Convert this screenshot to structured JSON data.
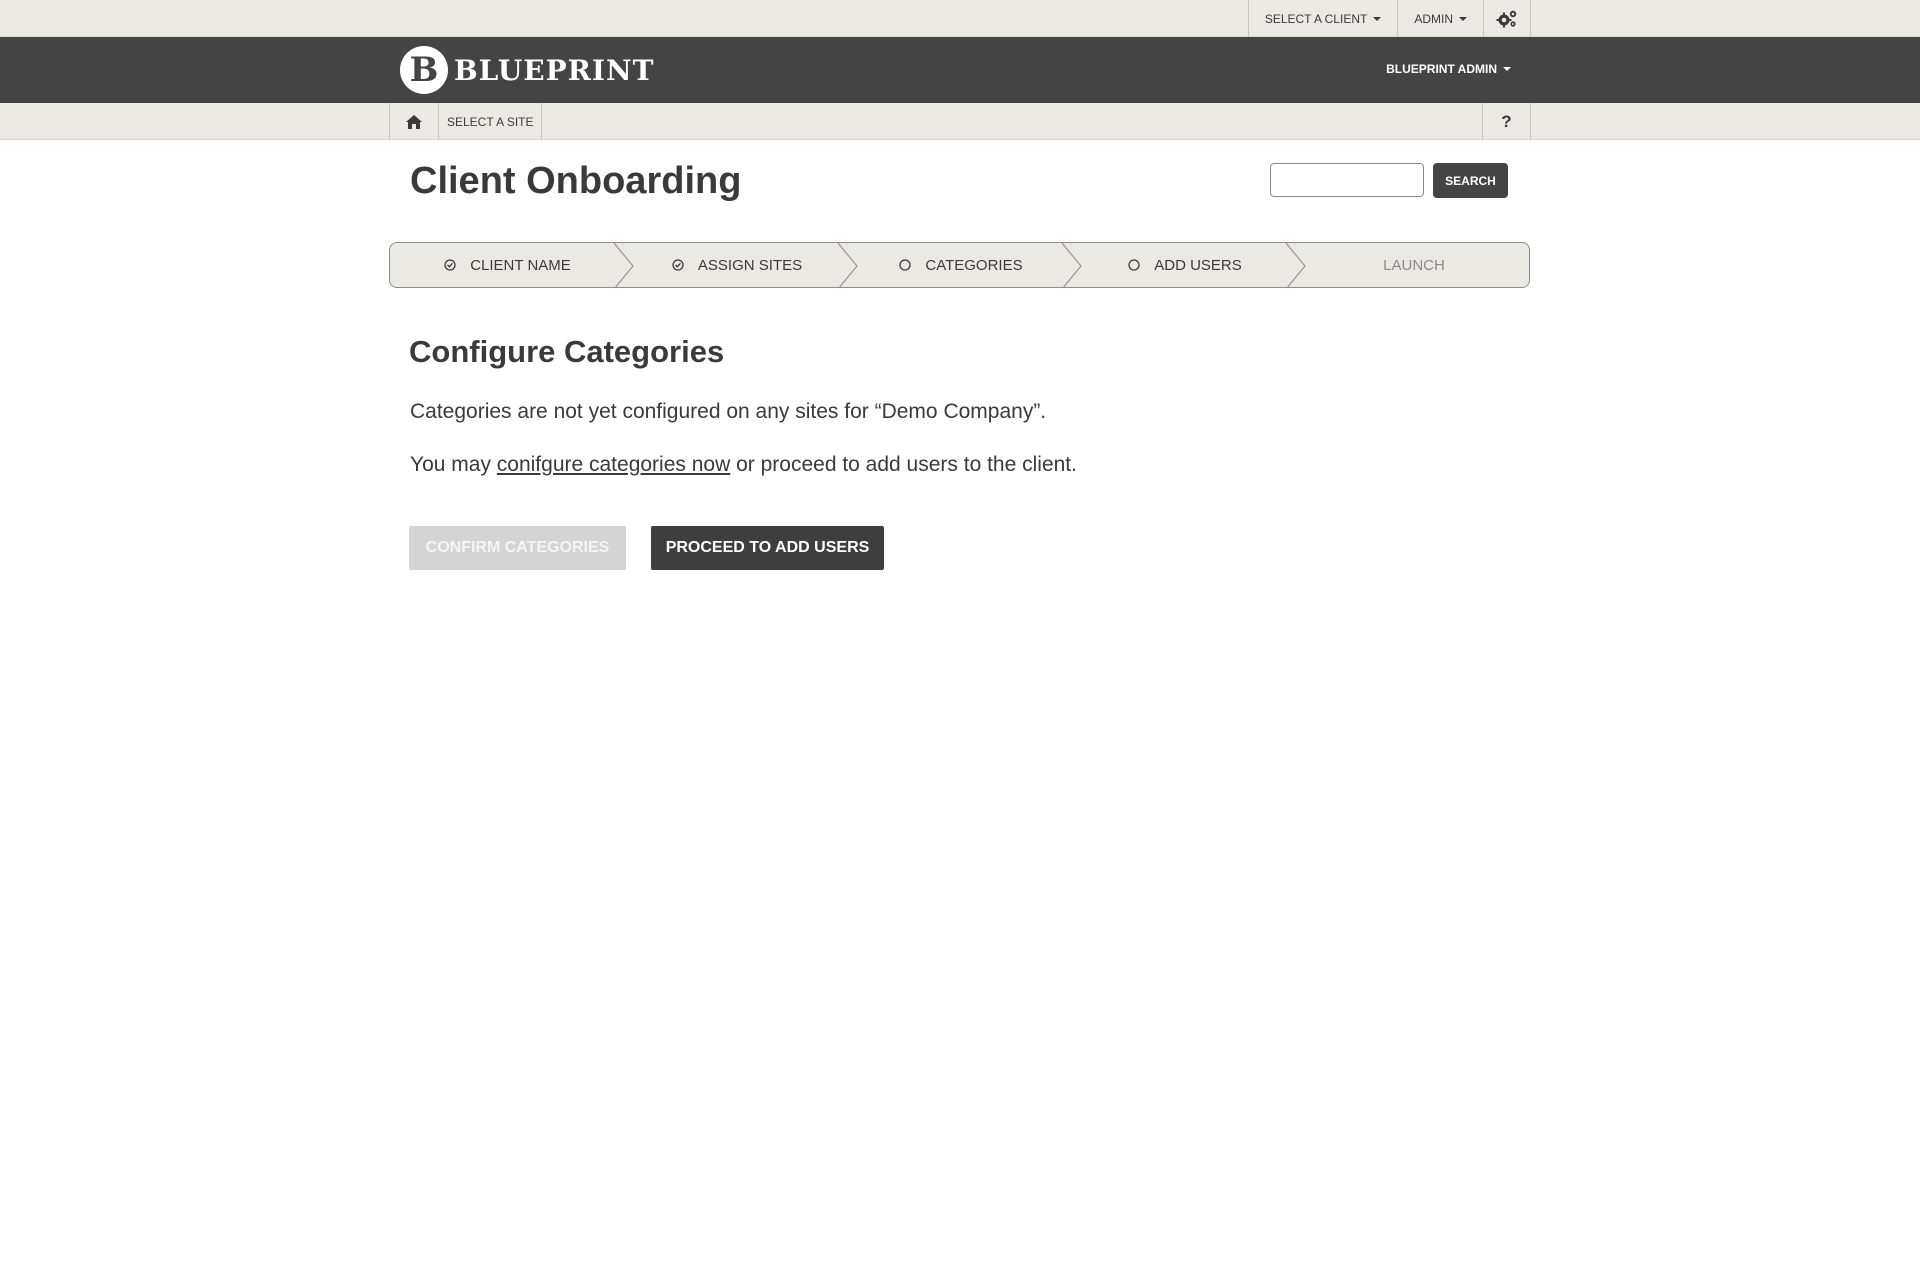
{
  "utility": {
    "select_client": "SELECT A CLIENT",
    "admin": "ADMIN",
    "settings_icon": "gears-icon"
  },
  "header": {
    "logo_letter": "B",
    "logo_text": "BLUEPRINT",
    "user_menu": "BLUEPRINT ADMIN"
  },
  "subnav": {
    "home_icon": "home-icon",
    "select_site": "SELECT A SITE",
    "help": "?"
  },
  "page": {
    "title": "Client Onboarding"
  },
  "search": {
    "placeholder": "",
    "value": "",
    "button_label": "SEARCH"
  },
  "wizard": {
    "steps": [
      {
        "label": "CLIENT NAME",
        "icon": "check-circle-icon",
        "state": "complete"
      },
      {
        "label": "ASSIGN SITES",
        "icon": "check-circle-icon",
        "state": "complete"
      },
      {
        "label": "CATEGORIES",
        "icon": "circle-icon",
        "state": "current"
      },
      {
        "label": "ADD USERS",
        "icon": "circle-icon",
        "state": "pending"
      },
      {
        "label": "LAUNCH",
        "icon": "",
        "state": "disabled"
      }
    ]
  },
  "content": {
    "section_title": "Configure Categories",
    "para1": "Categories are not yet configured on any sites for  “Demo Company”.",
    "para2_prefix": "You may ",
    "para2_link": "conifgure categories now",
    "para2_suffix": " or proceed to add users to the client.",
    "confirm_label": "CONFIRM CATEGORIES",
    "proceed_label": "PROCEED TO ADD USERS"
  },
  "colors": {
    "dark_header": "#444444",
    "light_bar": "#ebe9e4",
    "text": "#3a3a3a",
    "disabled_button": "#d4d4d4"
  }
}
